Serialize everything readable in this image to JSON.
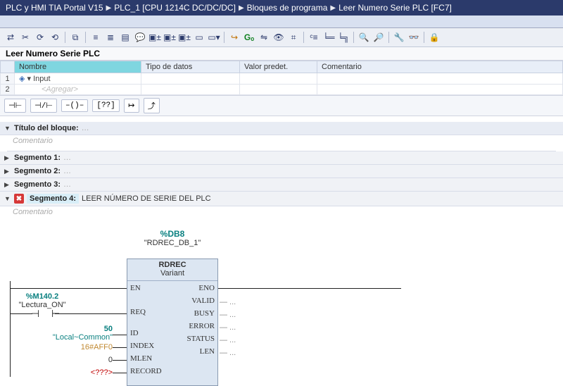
{
  "breadcrumb": {
    "project": "PLC y HMI TIA Portal V15",
    "device": "PLC_1 [CPU 1214C DC/DC/DC]",
    "folder": "Bloques de programa",
    "block": "Leer Numero Serie PLC [FC7]"
  },
  "block_title": "Leer Numero Serie PLC",
  "decl_headers": {
    "name": "Nombre",
    "type": "Tipo de datos",
    "default": "Valor predet.",
    "comment": "Comentario"
  },
  "decl_row": {
    "num": "1",
    "section": "Input",
    "add": "<Agregar>"
  },
  "palette": {
    "nc": "⊣⊢",
    "no": "⊣/⊢",
    "coil": "–()–",
    "box": "[??]",
    "jump": "↦",
    "ret": "⤴"
  },
  "sections": {
    "block": {
      "label": "Título del bloque:",
      "comment": "Comentario"
    },
    "seg1": {
      "label": "Segmento 1:"
    },
    "seg2": {
      "label": "Segmento 2:"
    },
    "seg3": {
      "label": "Segmento 3:"
    },
    "seg4": {
      "label": "Segmento 4:",
      "desc": "LEER NÚMERO DE SERIE DEL PLC",
      "comment": "Comentario"
    }
  },
  "fb": {
    "db_addr": "%DB8",
    "db_name": "\"RDREC_DB_1\"",
    "title": "RDREC",
    "subtitle": "Variant",
    "pins_left": [
      "EN",
      "REQ",
      "ID",
      "INDEX",
      "MLEN",
      "RECORD"
    ],
    "pins_right": [
      "ENO",
      "VALID",
      "BUSY",
      "ERROR",
      "STATUS",
      "LEN"
    ]
  },
  "inputs": {
    "req": {
      "addr": "%M140.2",
      "name": "\"Lectura_ON\""
    },
    "id": {
      "val": "50",
      "name": "\"Local~Common\""
    },
    "index": {
      "val": "16#AFF0"
    },
    "mlen": {
      "val": "0"
    },
    "record": {
      "val": "<???>"
    }
  },
  "out_stub": "— ..."
}
